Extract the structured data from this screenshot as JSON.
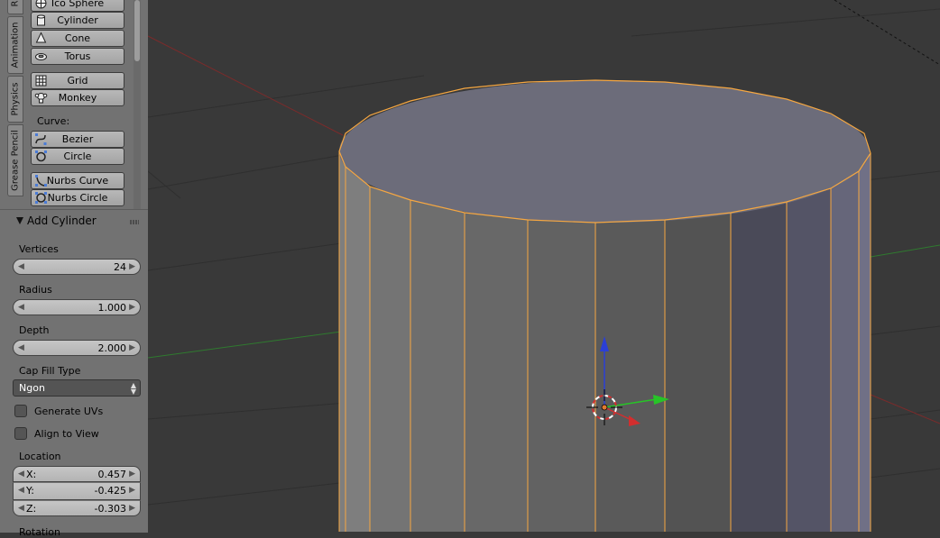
{
  "side_tabs": [
    "Animation",
    "Physics",
    "Grease Pencil"
  ],
  "side_tab_top_partial": "R",
  "tools": {
    "mesh_items": [
      {
        "label": "Ico Sphere",
        "icon": "ico-sphere-icon"
      },
      {
        "label": "Cylinder",
        "icon": "cylinder-icon"
      },
      {
        "label": "Cone",
        "icon": "cone-icon"
      },
      {
        "label": "Torus",
        "icon": "torus-icon"
      },
      {
        "label": "Grid",
        "icon": "grid-icon"
      },
      {
        "label": "Monkey",
        "icon": "monkey-icon"
      }
    ],
    "curve_label": "Curve:",
    "curve_items": [
      {
        "label": "Bezier",
        "icon": "bezier-icon"
      },
      {
        "label": "Circle",
        "icon": "circle-curve-icon"
      },
      {
        "label": "Nurbs Curve",
        "icon": "nurbs-curve-icon"
      },
      {
        "label": "Nurbs Circle",
        "icon": "nurbs-circle-icon"
      }
    ]
  },
  "operator": {
    "title": "Add Cylinder",
    "vertices_label": "Vertices",
    "vertices_value": "24",
    "radius_label": "Radius",
    "radius_value": "1.000",
    "depth_label": "Depth",
    "depth_value": "2.000",
    "cap_fill_label": "Cap Fill Type",
    "cap_fill_value": "Ngon",
    "generate_uvs_label": "Generate UVs",
    "generate_uvs_checked": false,
    "align_view_label": "Align to View",
    "align_view_checked": false,
    "location_label": "Location",
    "location": [
      {
        "key": "X:",
        "value": "0.457"
      },
      {
        "key": "Y:",
        "value": "-0.425"
      },
      {
        "key": "Z:",
        "value": "-0.303"
      }
    ],
    "rotation_label_partial": "Rotation"
  },
  "colors": {
    "viewport_bg": "#393939",
    "selection_outline": "#f5a742",
    "axis_x": "#d22e2e",
    "axis_y": "#27c427",
    "axis_z": "#2b3fd6"
  }
}
